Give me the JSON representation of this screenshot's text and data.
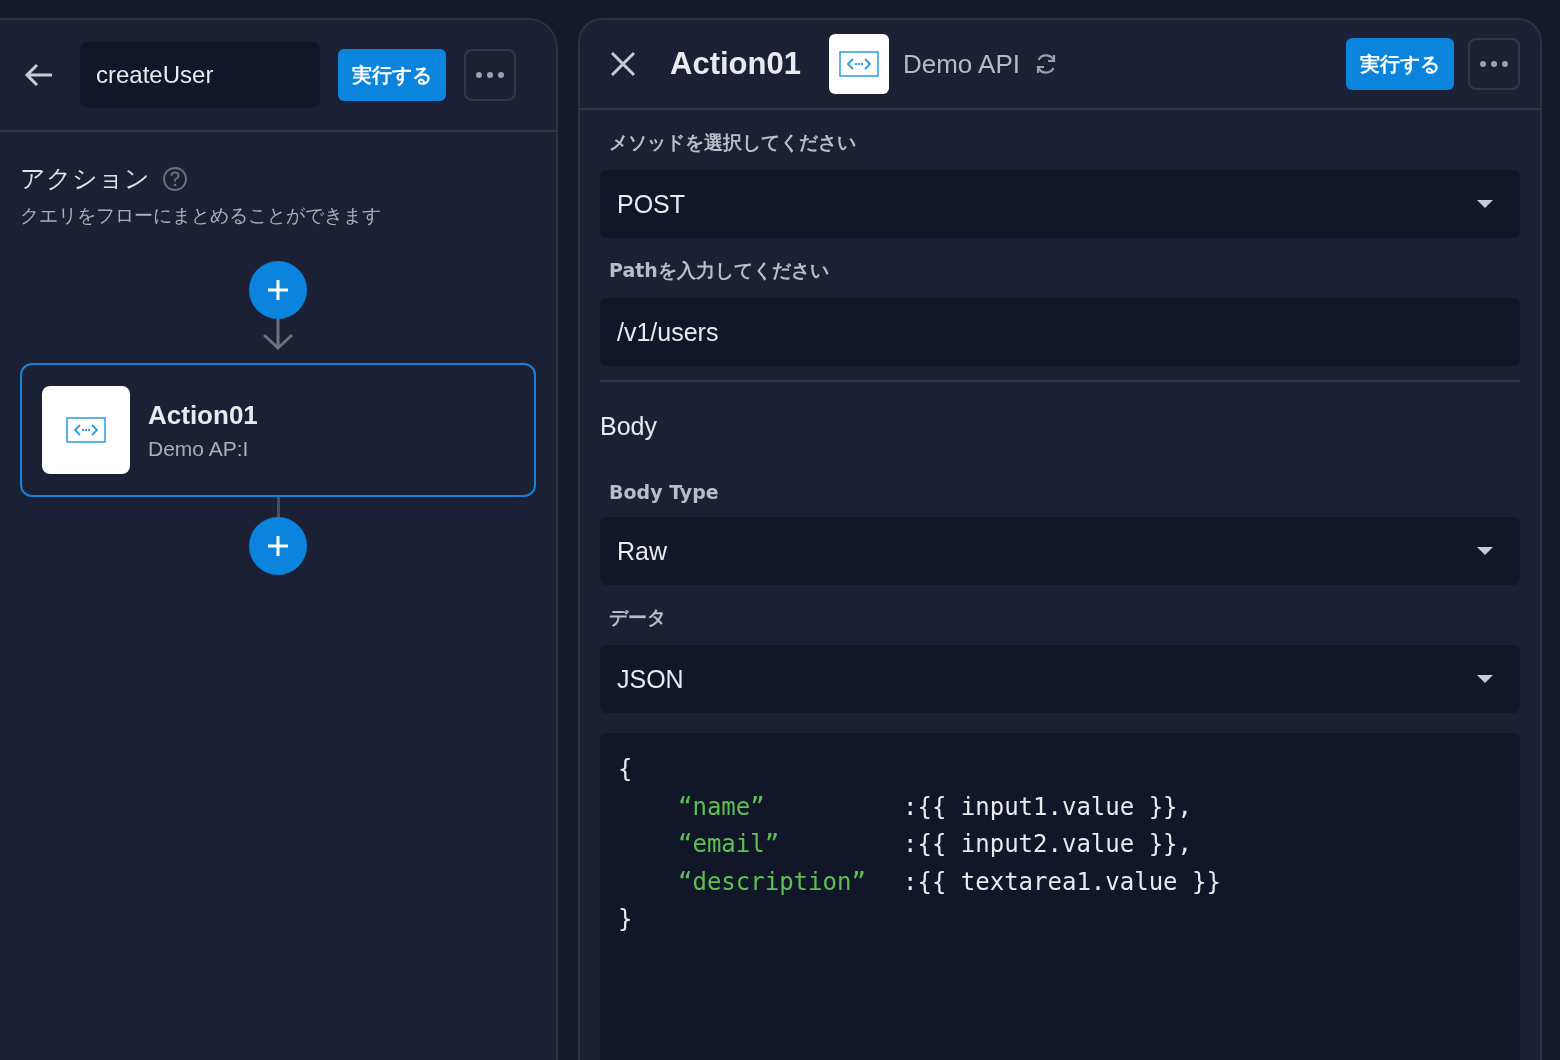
{
  "flow_editor": {
    "flow_name": "createUser",
    "run_button": "実行する",
    "section_title": "アクション",
    "section_subtitle": "クエリをフローにまとめることができます",
    "nodes": [
      {
        "title": "Action01",
        "subtitle": "Demo AP:I",
        "selected": true
      }
    ]
  },
  "action_panel": {
    "title": "Action01",
    "resource": "Demo API",
    "run_button": "実行する",
    "fields": [
      {
        "label": "メソッドを選択してください",
        "kind": "select",
        "value": "POST"
      },
      {
        "label": "Pathを入力してください",
        "kind": "input",
        "value": "/v1/users"
      }
    ],
    "body_heading": "Body",
    "body_fields": [
      {
        "label": "Body Type",
        "kind": "select",
        "value": "Raw"
      },
      {
        "label": "データ",
        "kind": "select",
        "value": "JSON"
      }
    ],
    "code_lines": [
      {
        "text": "{"
      },
      {
        "key": "“name”",
        "value": ":{{ input1.value }},"
      },
      {
        "key": "“email”",
        "value": ":{{ input2.value }},"
      },
      {
        "key": "“description”",
        "value": ":{{ textarea1.value }}"
      },
      {
        "text": "}"
      }
    ]
  }
}
